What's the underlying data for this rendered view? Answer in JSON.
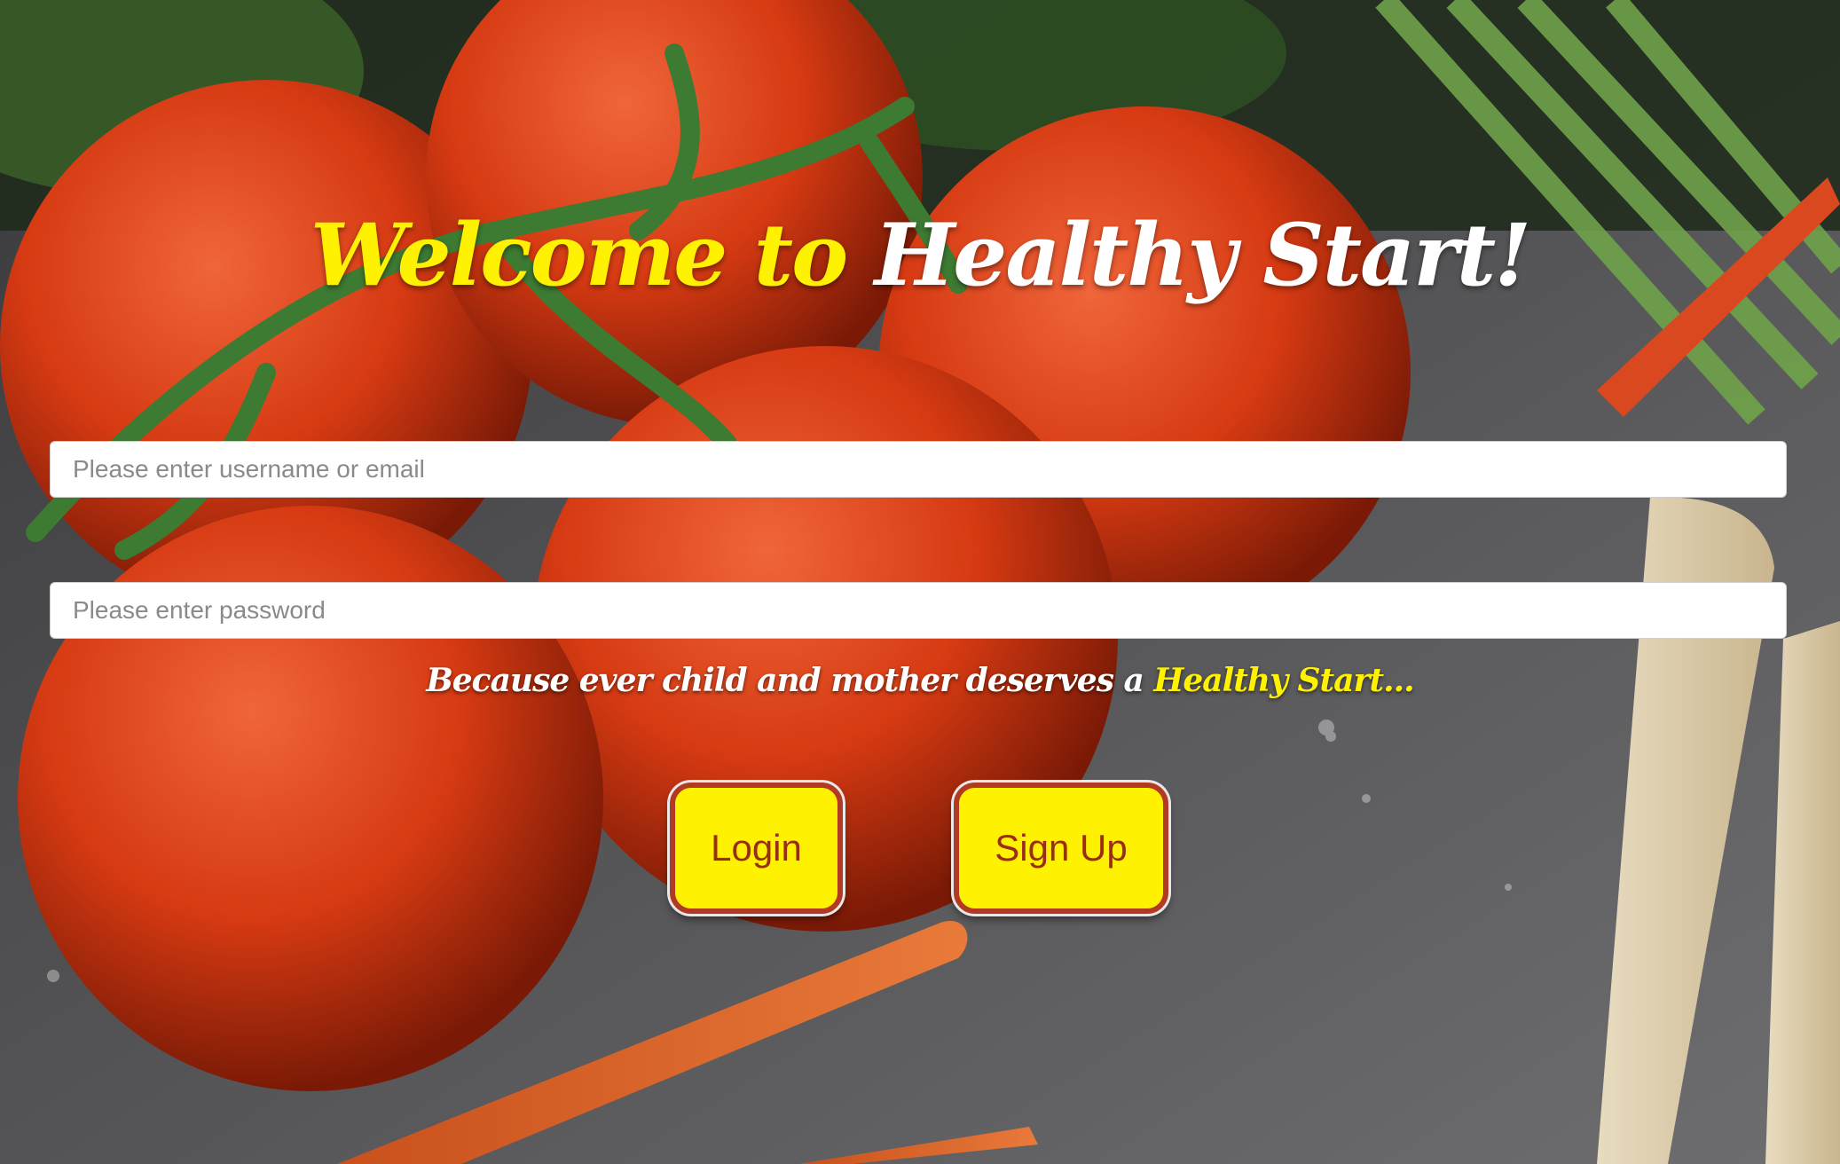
{
  "header": {
    "title_part1": "Welcome to ",
    "title_part2": "Healthy Start!"
  },
  "form": {
    "username_placeholder": "Please enter username or email",
    "username_value": "",
    "password_placeholder": "Please enter password",
    "password_value": ""
  },
  "tagline": {
    "text": "Because ever child and mother deserves a ",
    "highlight": "Healthy Start..."
  },
  "buttons": {
    "login_label": "Login",
    "signup_label": "Sign Up"
  },
  "colors": {
    "accent_yellow": "#fff200",
    "button_border": "#b33a22",
    "button_text": "#9b2d17"
  }
}
